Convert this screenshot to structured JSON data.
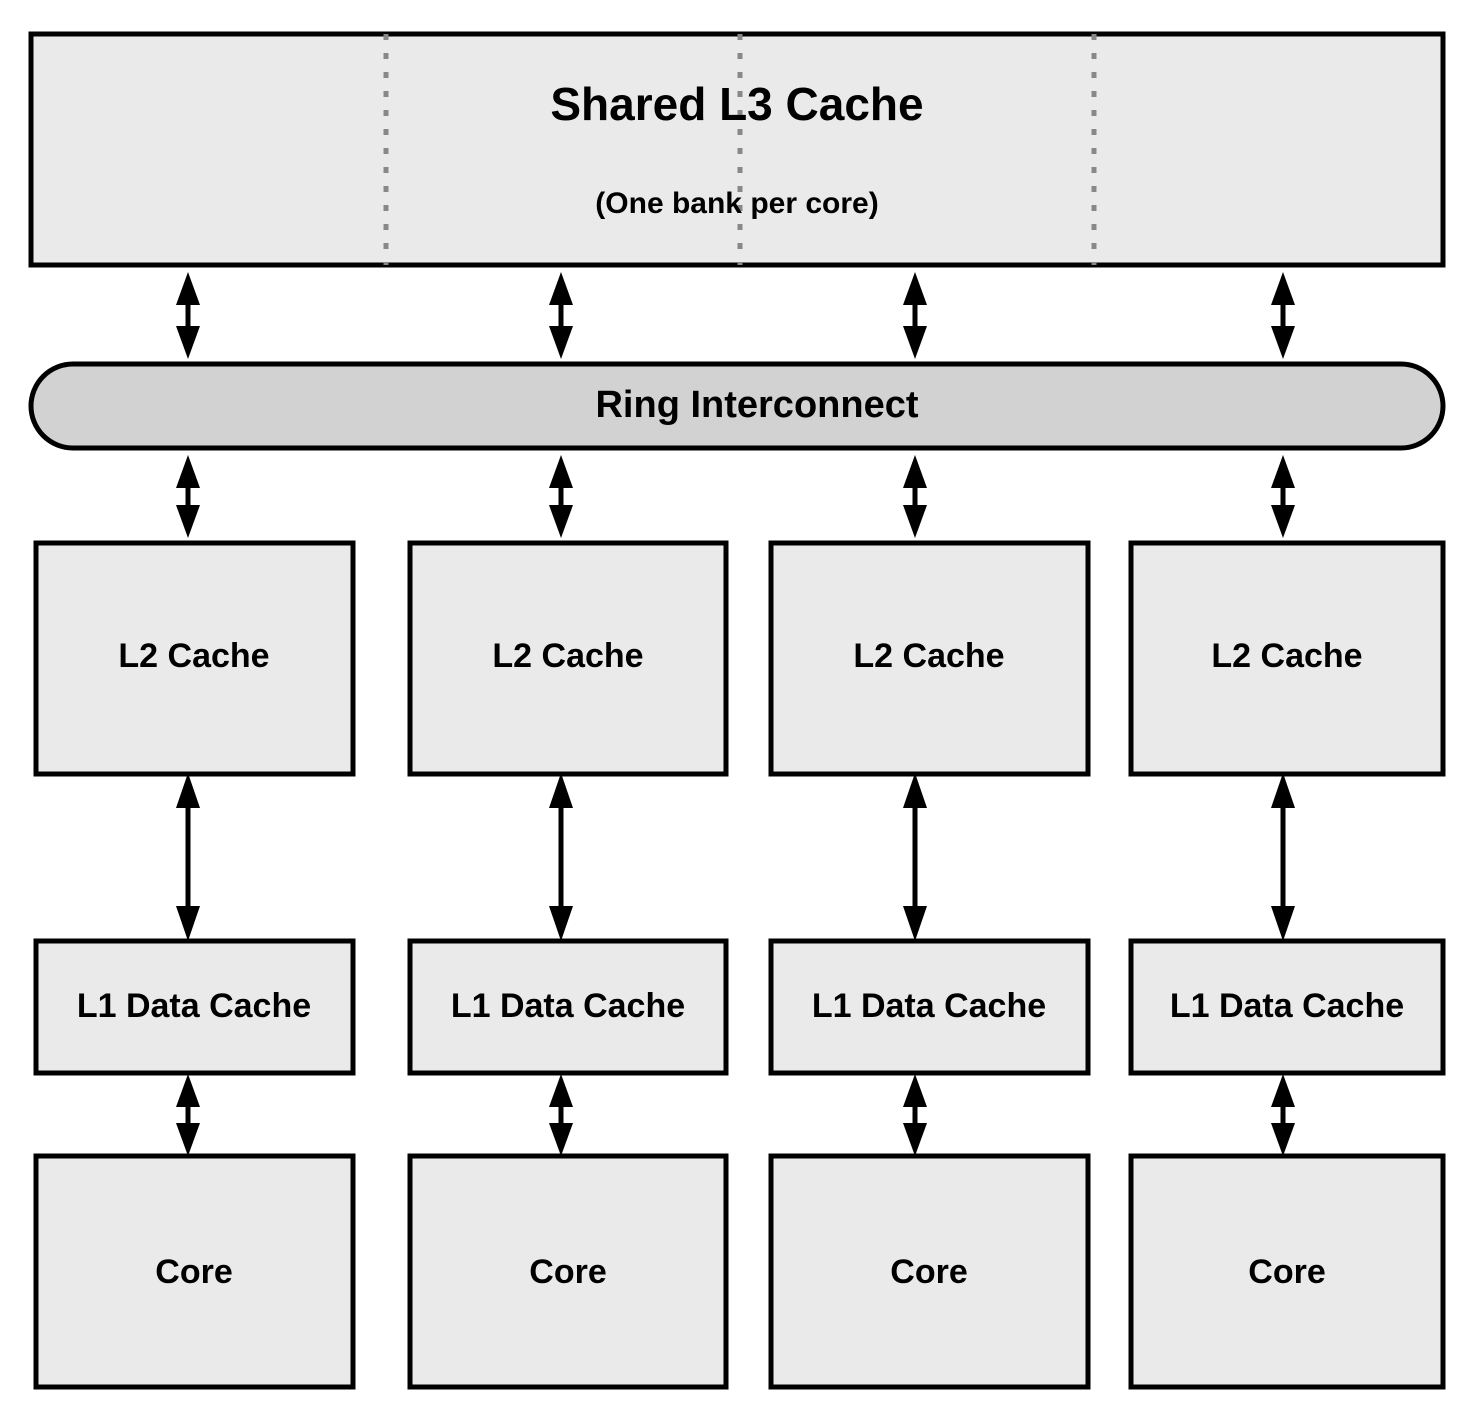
{
  "diagram": {
    "title_semantic": "multicore-cache-hierarchy-diagram",
    "colors": {
      "box_fill": "#eaeaea",
      "ring_fill": "#d2d2d2",
      "outline": "#000000",
      "divider": "#888888",
      "background": "#ffffff"
    }
  },
  "l3": {
    "title": "Shared L3 Cache",
    "subtitle": "(One bank per core)",
    "bank_count": 4,
    "divider_count": 3
  },
  "ring": {
    "label": "Ring Interconnect"
  },
  "columns": [
    {
      "l2": "L2 Cache",
      "l1": "L1 Data Cache",
      "core": "Core"
    },
    {
      "l2": "L2 Cache",
      "l1": "L1 Data Cache",
      "core": "Core"
    },
    {
      "l2": "L2 Cache",
      "l1": "L1 Data Cache",
      "core": "Core"
    },
    {
      "l2": "L2 Cache",
      "l1": "L1 Data Cache",
      "core": "Core"
    }
  ],
  "connections": {
    "l3_to_ring": "bidirectional-arrow",
    "ring_to_l2": "bidirectional-arrow",
    "l2_to_l1": "bidirectional-arrow",
    "l1_to_core": "bidirectional-arrow"
  }
}
